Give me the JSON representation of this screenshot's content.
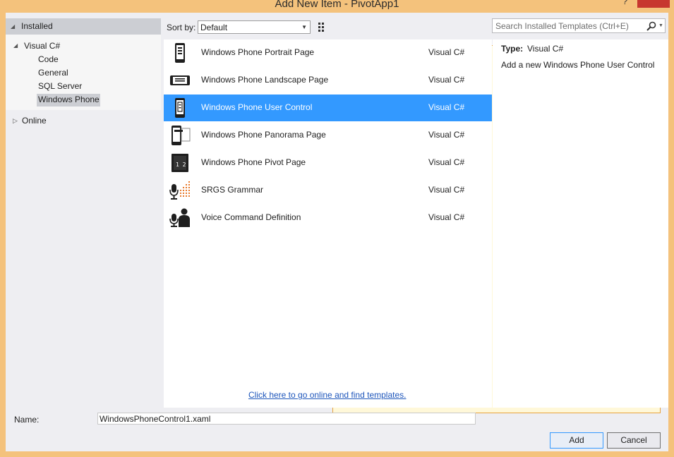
{
  "window": {
    "title": "Add New Item - PivotApp1",
    "help_label": "?"
  },
  "tree": {
    "installed": "Installed",
    "visual_csharp": "Visual C#",
    "children": [
      "Code",
      "General",
      "SQL Server",
      "Windows Phone"
    ],
    "selected": "Windows Phone",
    "online": "Online"
  },
  "sort": {
    "label": "Sort by:",
    "value": "Default"
  },
  "templates": [
    {
      "name": "Windows Phone Portrait Page",
      "lang": "Visual C#",
      "icon": "phone-portrait-icon"
    },
    {
      "name": "Windows Phone Landscape Page",
      "lang": "Visual C#",
      "icon": "phone-landscape-icon"
    },
    {
      "name": "Windows Phone User Control",
      "lang": "Visual C#",
      "icon": "user-control-icon",
      "selected": true
    },
    {
      "name": "Windows Phone Panorama Page",
      "lang": "Visual C#",
      "icon": "panorama-icon"
    },
    {
      "name": "Windows Phone Pivot Page",
      "lang": "Visual C#",
      "icon": "pivot-icon"
    },
    {
      "name": "SRGS Grammar",
      "lang": "Visual C#",
      "icon": "srgs-grammar-icon"
    },
    {
      "name": "Voice Command Definition",
      "lang": "Visual C#",
      "icon": "voice-command-icon"
    }
  ],
  "online_link": "Click here to go online and find templates.",
  "search": {
    "placeholder": "Search Installed Templates (Ctrl+E)"
  },
  "details": {
    "type_label": "Type:",
    "type_value": "Visual C#",
    "description": "Add a new Windows Phone User Control"
  },
  "name_field": {
    "label": "Name:",
    "value": "WindowsPhoneControl1.xaml"
  },
  "buttons": {
    "add": "Add",
    "cancel": "Cancel"
  },
  "colors": {
    "accent": "#3399ff",
    "frame": "#f4c27c",
    "close": "#c7372f",
    "link": "#1e56bb"
  }
}
